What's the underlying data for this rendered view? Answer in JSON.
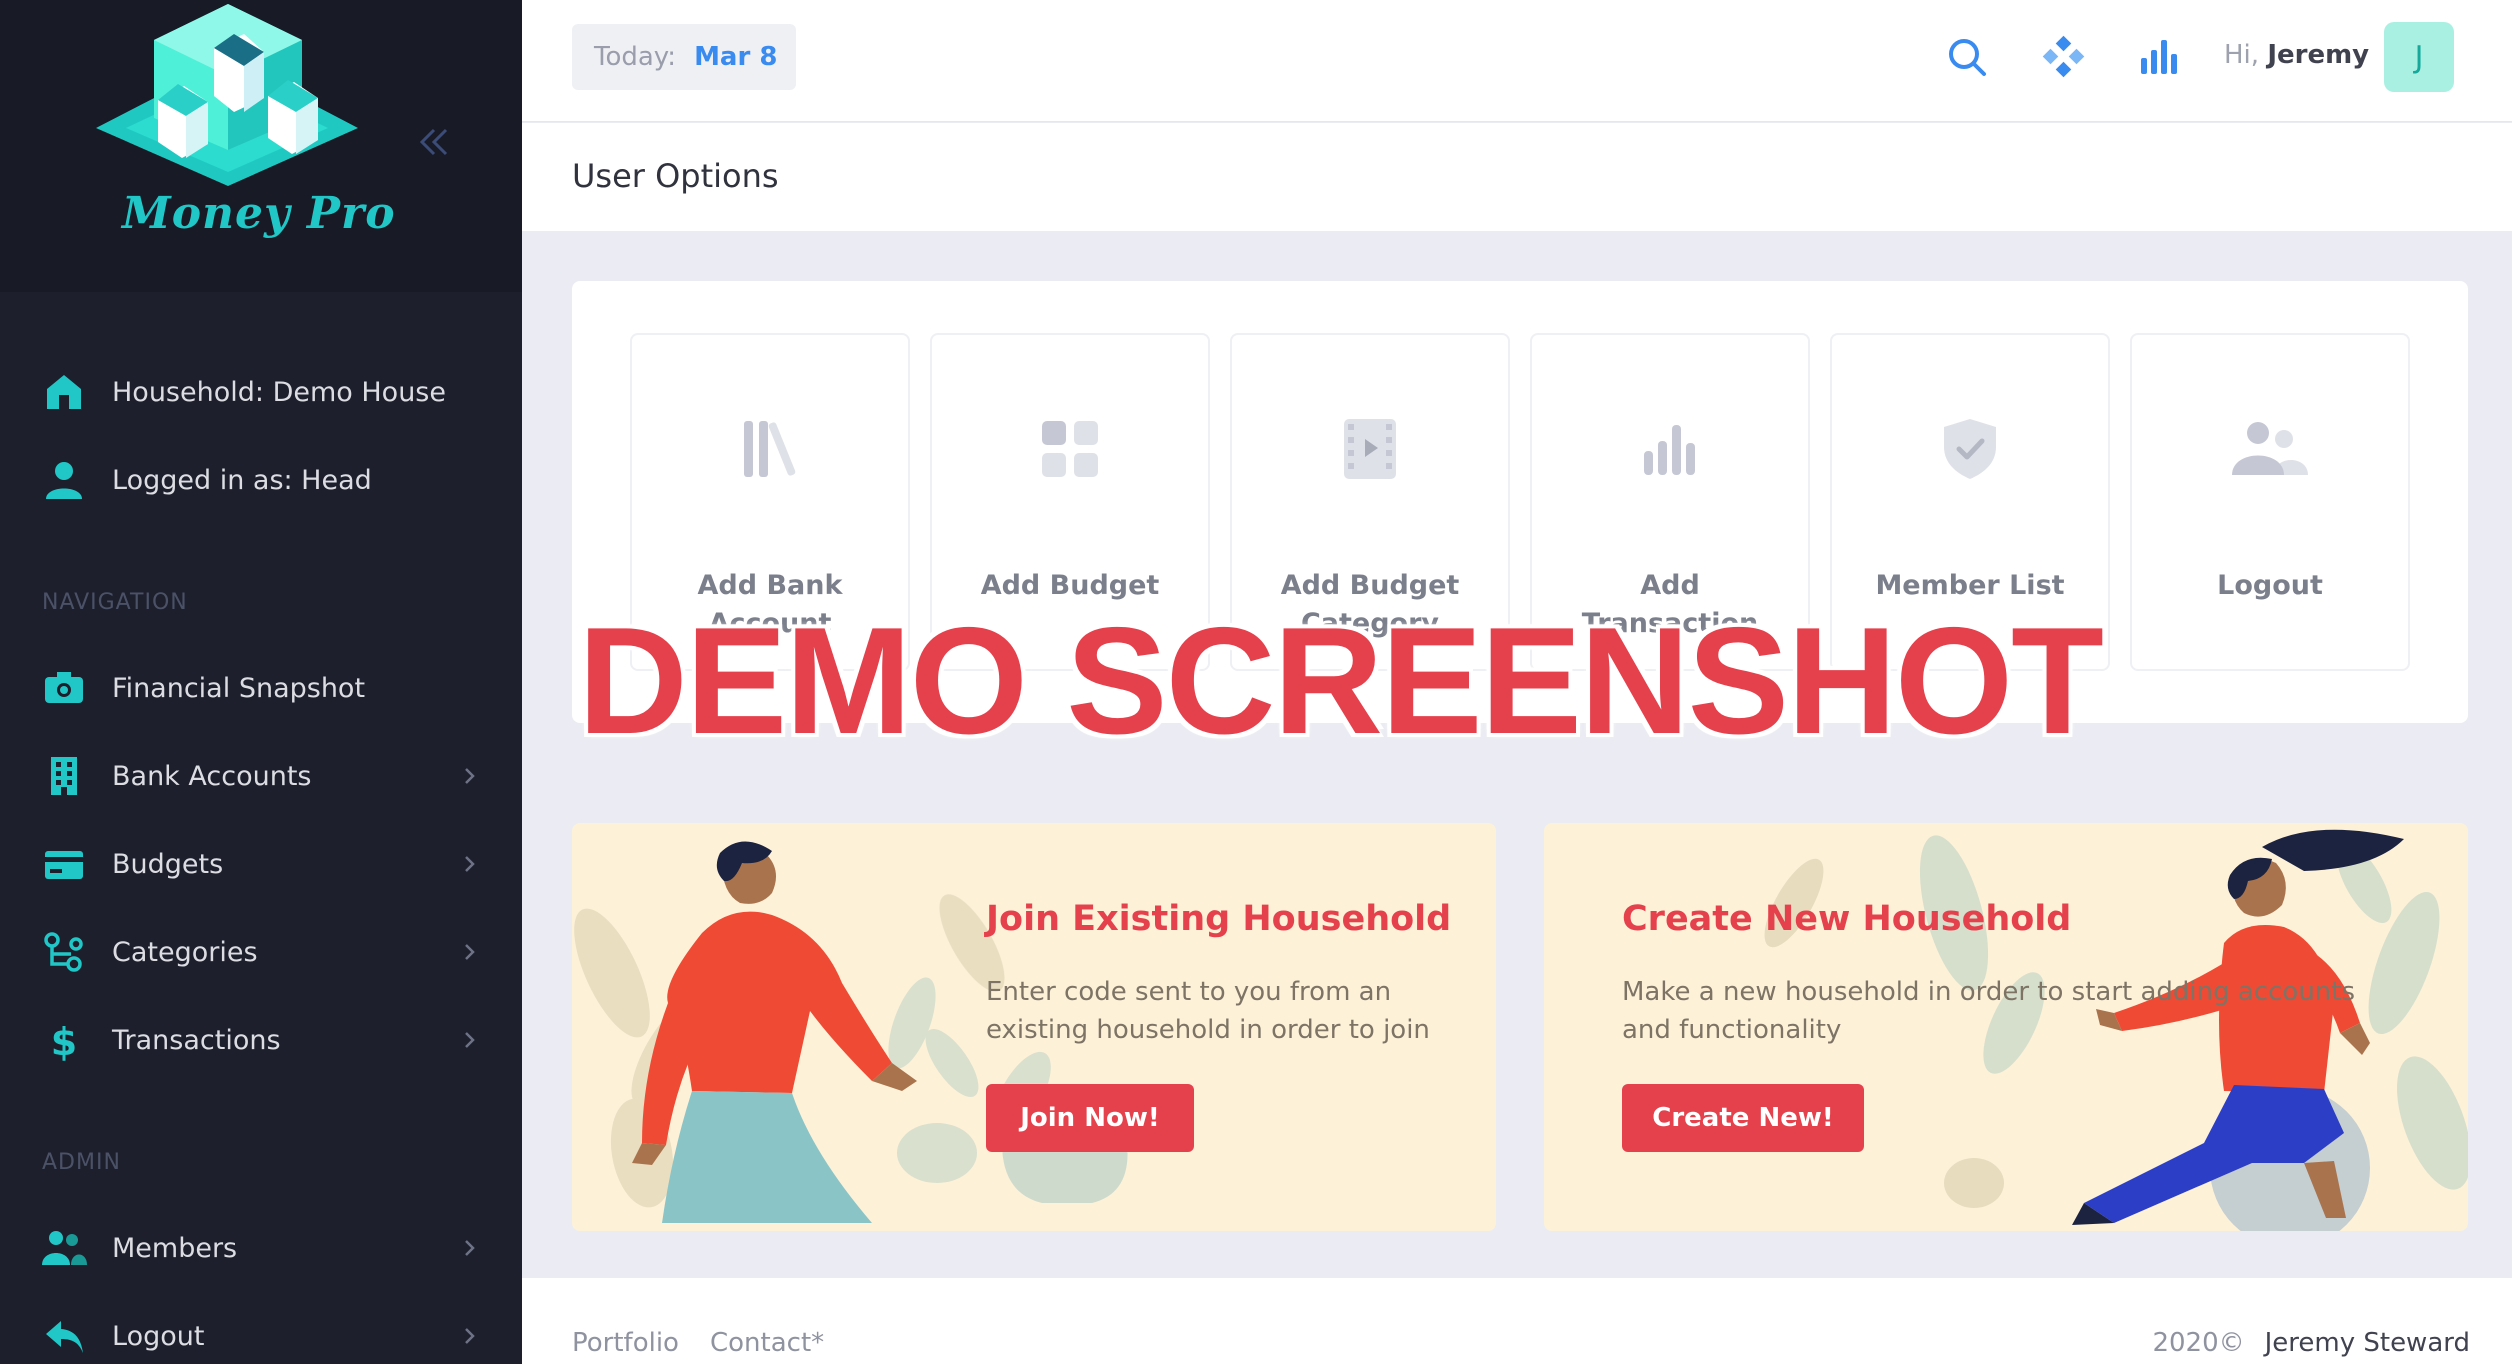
{
  "app": {
    "logo_text": "Money Pro",
    "accent": "#21c7c7",
    "brand_red": "#e5414c"
  },
  "sidebar": {
    "info": [
      {
        "label": "Household: Demo House",
        "icon": "home-icon"
      },
      {
        "label": "Logged in as: Head",
        "icon": "user-icon"
      }
    ],
    "nav_header": "NAVIGATION",
    "nav_items": [
      {
        "label": "Financial Snapshot",
        "icon": "camera-icon"
      },
      {
        "label": "Bank Accounts",
        "icon": "building-icon"
      },
      {
        "label": "Budgets",
        "icon": "credit-card-icon"
      },
      {
        "label": "Categories",
        "icon": "categories-icon"
      },
      {
        "label": "Transactions",
        "icon": "dollar-icon"
      }
    ],
    "admin_header": "ADMIN",
    "admin_items": [
      {
        "label": "Members",
        "icon": "users-icon"
      },
      {
        "label": "Logout",
        "icon": "logout-arrow-icon"
      }
    ]
  },
  "topbar": {
    "today_label": "Today:",
    "today_value": "Mar 8",
    "greeting_prefix": "Hi,",
    "user_name": "Jeremy",
    "avatar_initial": "J"
  },
  "page": {
    "title": "User Options"
  },
  "options": [
    {
      "line1": "Add Bank",
      "line2": "Account",
      "icon": "bank-books-icon"
    },
    {
      "line1": "Add Budget",
      "line2": "",
      "icon": "grid-icon"
    },
    {
      "line1": "Add Budget",
      "line2": "Category",
      "icon": "film-icon"
    },
    {
      "line1": "Add",
      "line2": "Transaction",
      "icon": "bar-chart-icon"
    },
    {
      "line1": "Member List",
      "line2": "",
      "icon": "shield-check-icon"
    },
    {
      "line1": "Logout",
      "line2": "",
      "icon": "users-group-icon"
    }
  ],
  "watermark": "DEMO SCREENSHOT",
  "banners": {
    "join": {
      "title": "Join Existing Household",
      "desc_line1": "Enter code sent to you from an",
      "desc_line2": "existing household in order to join",
      "button": "Join Now!"
    },
    "create": {
      "title": "Create New Household",
      "desc_line1": "Make a new household in order to start adding accounts",
      "desc_line2": "and functionality",
      "button": "Create New!"
    }
  },
  "footer": {
    "link_portfolio": "Portfolio",
    "link_contact": "Contact*",
    "copyright": "2020©",
    "author": "Jeremy Steward"
  }
}
